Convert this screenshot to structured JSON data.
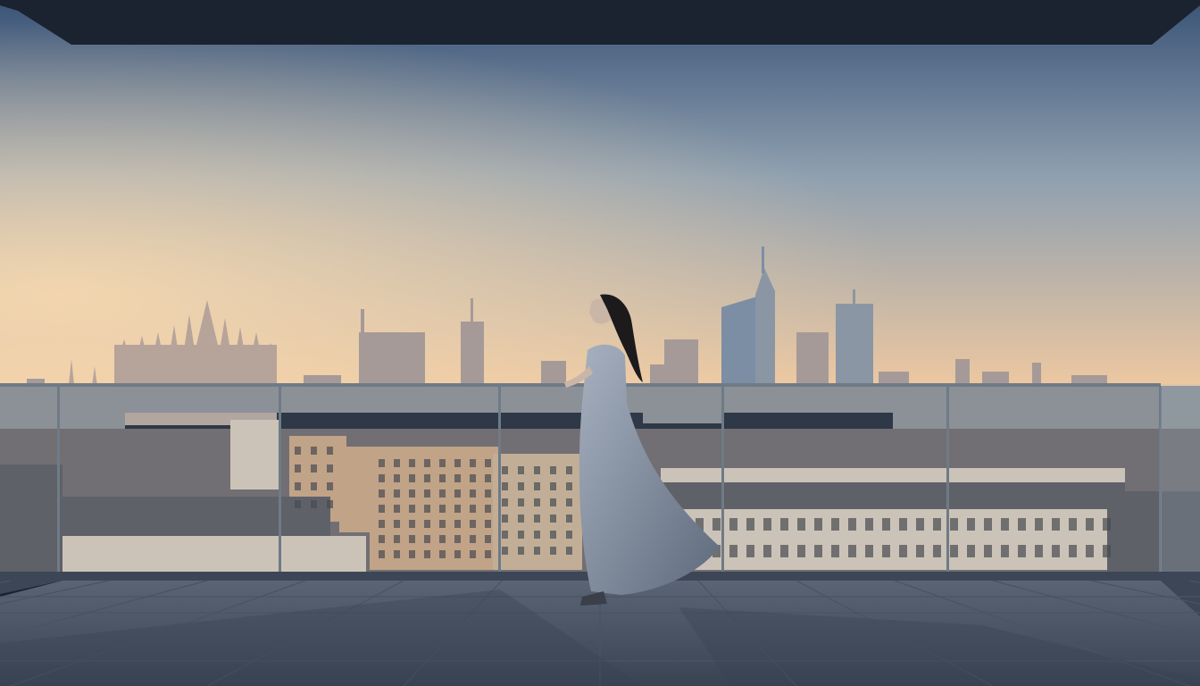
{
  "scene": {
    "subject": "woman-standing-on-rooftop-terrace",
    "colors": {
      "sky_top": "#3b5477",
      "sky_mid": "#8fa0b0",
      "sky_horizon": "#f0c9a0",
      "sun_glow": "#f7d9b0",
      "skyline_far": "#a59a98",
      "skyline_mid": "#8a8a90",
      "city_near": "#6b6466",
      "cathedral": "#b6a49a",
      "building_warm": "#c7a07d",
      "building_light": "#d4c5b6",
      "tower_glass": "#7c8ea3",
      "ceiling": "#1b2230",
      "floor": "#5a6474",
      "floor_shadow": "#3a4352",
      "glass": "#9fb5c8",
      "railing": "#6f7b86",
      "dress": "#8894a5",
      "hair": "#1d1a1c",
      "skin": "#c9b6a6"
    }
  }
}
